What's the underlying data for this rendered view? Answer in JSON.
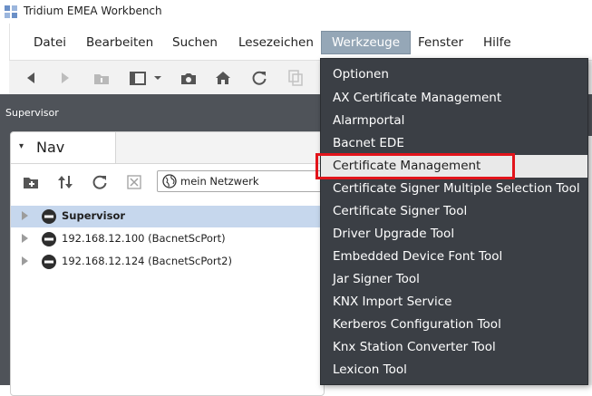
{
  "window": {
    "title": "Tridium EMEA Workbench"
  },
  "menubar": {
    "items": [
      "Datei",
      "Bearbeiten",
      "Suchen",
      "Lesezeichen",
      "Werkzeuge",
      "Fenster",
      "Hilfe"
    ],
    "active": "Werkzeuge"
  },
  "toolbar": {
    "icons": [
      "back-arrow-icon",
      "forward-arrow-icon",
      "folder-up-icon",
      "panel-icon",
      "dropdown-icon",
      "camera-icon",
      "home-icon",
      "refresh-icon",
      "copy-icon"
    ]
  },
  "workspace": {
    "label": "Supervisor"
  },
  "nav": {
    "tab_label": "Nav",
    "search_value": "mein Netzwerk",
    "tree": [
      {
        "label": "Supervisor",
        "selected": true
      },
      {
        "label": "192.168.12.100 (BacnetScPort)",
        "selected": false
      },
      {
        "label": "192.168.12.124 (BacnetScPort2)",
        "selected": false
      }
    ]
  },
  "dropdown": {
    "items": [
      "Optionen",
      "AX Certificate Management",
      "Alarmportal",
      "Bacnet EDE",
      "Certificate Management",
      "Certificate Signer Multiple Selection Tool",
      "Certificate Signer Tool",
      "Driver Upgrade Tool",
      "Embedded Device Font Tool",
      "Jar Signer Tool",
      "KNX Import Service",
      "Kerberos Configuration Tool",
      "Knx Station Converter Tool",
      "Lexicon Tool"
    ],
    "highlighted": "Certificate Management"
  },
  "colors": {
    "menu_active_bg": "#95a7b7",
    "dropdown_bg": "#3b3f45",
    "highlight_border": "#e2141b",
    "tree_selected_bg": "#c6d7ed"
  }
}
